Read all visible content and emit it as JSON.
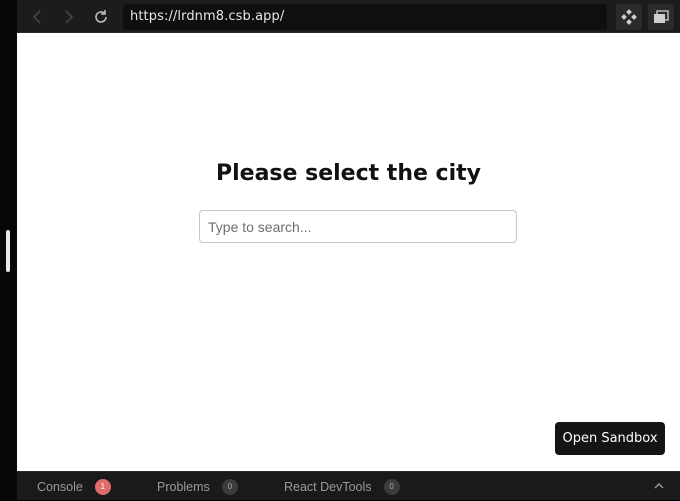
{
  "browser": {
    "url": "https://lrdnm8.csb.app/"
  },
  "page": {
    "title": "Please select the city",
    "search_placeholder": "Type to search...",
    "open_sandbox_label": "Open Sandbox"
  },
  "bottom_tabs": [
    {
      "label": "Console",
      "count": "1"
    },
    {
      "label": "Problems",
      "count": "0"
    },
    {
      "label": "React DevTools",
      "count": "0"
    }
  ],
  "icons": {
    "back": "chevron-left-icon",
    "forward": "chevron-right-icon",
    "reload": "reload-icon",
    "preview": "diamond-grid-icon",
    "window": "window-stack-icon",
    "collapse": "chevron-up-icon"
  },
  "colors": {
    "console_badge": "#e06b6b",
    "toolbar_bg": "#1c1c1c",
    "button_bg": "#151515"
  }
}
